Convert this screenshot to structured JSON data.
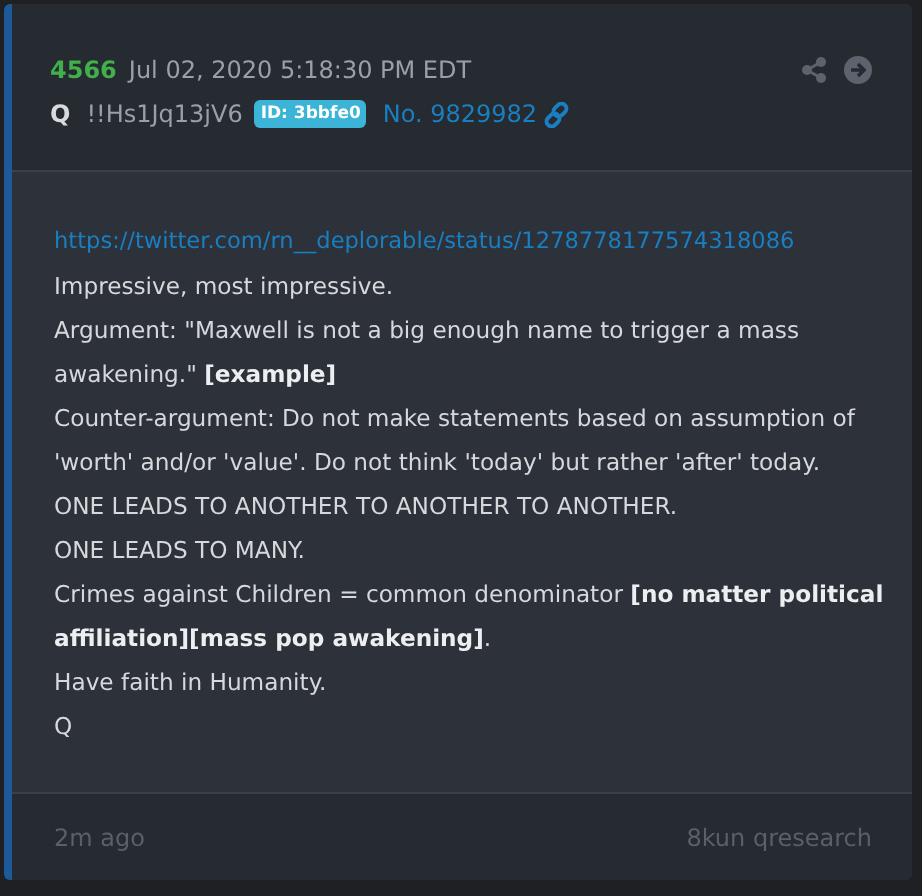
{
  "post": {
    "number": "4566",
    "date": "Jul 02, 2020 5:18:30 PM EDT",
    "author": "Q",
    "tripcode": "!!Hs1Jq13jV6",
    "id_badge": "ID: 3bbfe0",
    "post_no": "No. 9829982",
    "lines": [
      {
        "kind": "link",
        "text": "https://twitter.com/rn__deplorable/status/1278778177574318086"
      },
      {
        "kind": "text",
        "text": "Impressive, most impressive."
      },
      {
        "kind": "text",
        "text": "Argument: \"Maxwell is not a big enough name to trigger a mass awakening.\" **[example]**"
      },
      {
        "kind": "text",
        "text": "Counter-argument: Do not make statements based on assumption of 'worth' and/or 'value'. Do not think 'today' but rather 'after' today."
      },
      {
        "kind": "text",
        "text": "ONE LEADS TO ANOTHER TO ANOTHER TO ANOTHER."
      },
      {
        "kind": "text",
        "text": "ONE LEADS TO MANY."
      },
      {
        "kind": "text",
        "text": "Crimes against Children = common denominator **[no matter political affiliation][mass pop awakening]**."
      },
      {
        "kind": "text",
        "text": "Have faith in Humanity."
      },
      {
        "kind": "text",
        "text": "Q"
      }
    ],
    "time_ago": "2m ago",
    "source": "8kun qresearch"
  }
}
